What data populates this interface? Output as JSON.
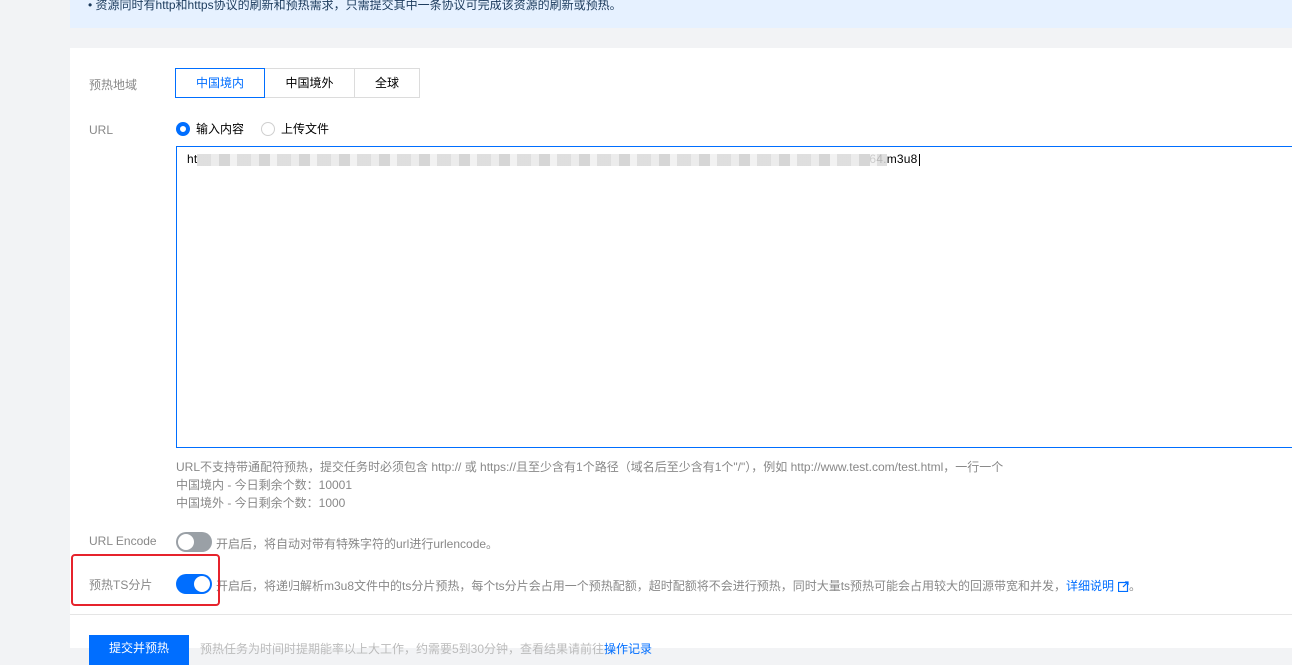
{
  "notice": {
    "text": "• 资源同时有http和https协议的刷新和预热需求，只需提交其中一条协议可完成该资源的刷新或预热。"
  },
  "region": {
    "label": "预热地域",
    "options": [
      "中国境内",
      "中国境外",
      "全球"
    ],
    "selected": "中国境内"
  },
  "url": {
    "label": "URL",
    "radio_input": "输入内容",
    "radio_upload": "上传文件",
    "selected": "输入内容",
    "value_prefix": "ht",
    "value_suffix": "64.m3u8"
  },
  "help": {
    "line1": "URL不支持带通配符预热，提交任务时必须包含 http:// 或 https://且至少含有1个路径（域名后至少含有1个\"/\"），例如 http://www.test.com/test.html，一行一个",
    "line2": "中国境内 - 今日剩余个数：10001",
    "line3": "中国境外 - 今日剩余个数：1000"
  },
  "url_encode": {
    "label": "URL Encode",
    "state": "off",
    "desc": "开启后，将自动对带有特殊字符的url进行urlencode。"
  },
  "ts_split": {
    "label": "预热TS分片",
    "state": "on",
    "desc": "开启后，将递归解析m3u8文件中的ts分片预热，每个ts分片会占用一个预热配额，超时配额将不会进行预热，同时大量ts预热可能会占用较大的回源带宽和并发，",
    "link": "详细说明",
    "tail": "。"
  },
  "footer": {
    "submit": "提交并预热",
    "note": "预热任务为时间时提期能率以上大工作，约需要5到30分钟，查看结果请前往",
    "link": "操作记录"
  },
  "colors": {
    "accent": "#006eff",
    "highlight": "#e6232c",
    "notice_bg": "#e6f1ff"
  },
  "icons": {
    "external": "external-link-icon"
  }
}
